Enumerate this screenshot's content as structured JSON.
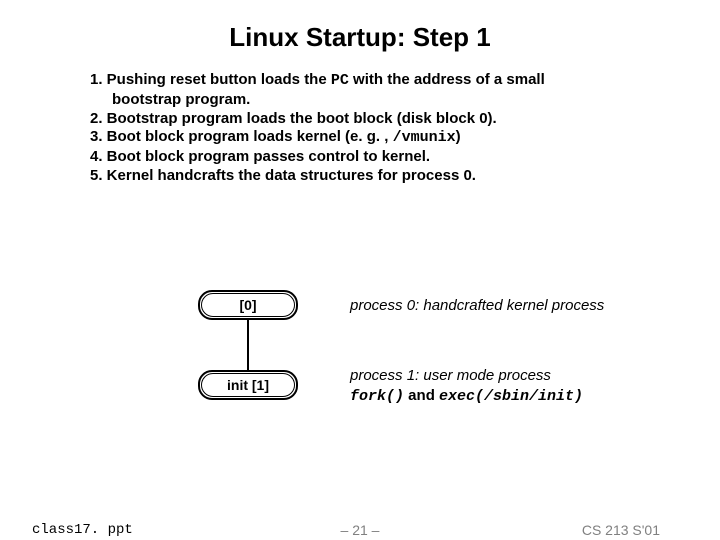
{
  "title": "Linux Startup: Step 1",
  "steps": {
    "s1a": "1. Pushing reset button loads the ",
    "s1pc": "PC",
    "s1b": " with the address of a small",
    "s1c": "bootstrap program.",
    "s2": "2. Bootstrap program loads the boot block (disk block 0).",
    "s3a": "3. Boot block program loads kernel  (e. g. , ",
    "s3m": "/vmunix",
    "s3b": ")",
    "s4": "4. Boot block program passes control to kernel.",
    "s5": "5. Kernel handcrafts the data structures for process 0."
  },
  "nodes": {
    "n0": "[0]",
    "n1": "init [1]"
  },
  "desc": {
    "d0": "process 0: handcrafted kernel process",
    "d1a": "process 1: user mode process",
    "d1_fork": "fork()",
    "d1_and": " and ",
    "d1_exec": "exec(/sbin/init)"
  },
  "footer": {
    "left": "class17. ppt",
    "center": "– 21 –",
    "right": "CS 213 S'01"
  }
}
